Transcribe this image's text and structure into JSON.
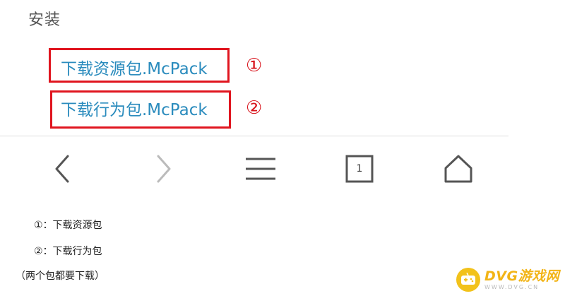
{
  "section": {
    "title": "安装"
  },
  "links": [
    {
      "label": "下载资源包.McPack",
      "marker": "①"
    },
    {
      "label": "下载行为包.McPack",
      "marker": "②"
    }
  ],
  "toolbar": {
    "back_icon": "chevron-left-icon",
    "forward_icon": "chevron-right-icon",
    "menu_icon": "hamburger-menu-icon",
    "tab_count": "1",
    "home_icon": "home-icon"
  },
  "notes": [
    "①：下载资源包",
    "②：下载行为包",
    "（两个包都要下载）"
  ],
  "watermark": {
    "brand": "DVG游戏网",
    "domain": "WWW.DVG.CN"
  },
  "colors": {
    "link": "#2a8bbd",
    "highlight_box": "#e0151f",
    "watermark": "#f2b416"
  }
}
